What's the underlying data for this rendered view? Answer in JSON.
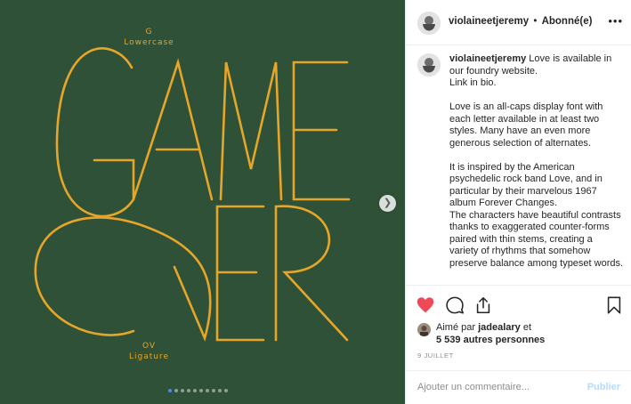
{
  "media": {
    "caption_top": [
      "G",
      "Lowercase"
    ],
    "caption_bottom": [
      "OV",
      "Ligature"
    ],
    "headline_top": "GAME",
    "headline_bottom": "OVER",
    "background_color": "#2f5137",
    "accent_color": "#e5a629",
    "carousel": {
      "total": 10,
      "active": 0
    }
  },
  "header": {
    "username": "violaineetjeremy",
    "separator": "•",
    "follow_status": "Abonné(e)",
    "more_icon": "ellipsis-icon"
  },
  "caption": {
    "username": "violaineetjeremy",
    "intro": "Love is available in our foundry website.",
    "link_line": "Link in bio.",
    "paragraph_2": "Love is an all-caps display font with each letter available in at least two styles. Many have an even more generous selection of alternates.",
    "paragraph_3": "It is inspired by the American psychedelic rock band Love, and in particular by their marvelous 1967 album Forever Changes.",
    "paragraph_4": "The characters have beautiful contrasts thanks to exaggerated counter-forms paired with thin stems, creating a variety of rhythms that somehow preserve balance among typeset words."
  },
  "actions": {
    "like": "heart-icon",
    "comment": "comment-icon",
    "share": "share-icon",
    "save": "bookmark-icon",
    "like_color": "#ed4956"
  },
  "likes": {
    "prefix": "Aimé par",
    "user": "jadealary",
    "conjunction": "et",
    "others": "5 539 autres personnes"
  },
  "date": "9 JUILLET",
  "comment_box": {
    "placeholder": "Ajouter un commentaire...",
    "post_label": "Publier"
  }
}
